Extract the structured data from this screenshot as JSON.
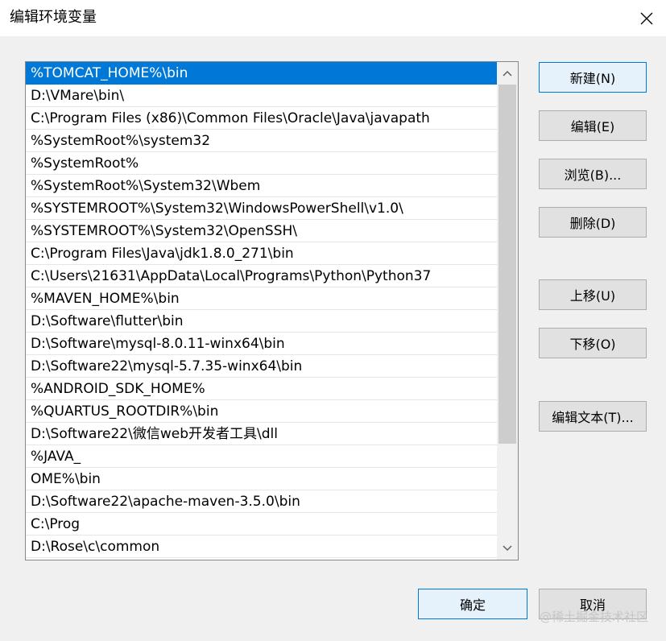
{
  "window": {
    "title": "编辑环境变量"
  },
  "list": {
    "items": [
      "%TOMCAT_HOME%\\bin",
      "D:\\VMare\\bin\\",
      "C:\\Program Files (x86)\\Common Files\\Oracle\\Java\\javapath",
      "%SystemRoot%\\system32",
      "%SystemRoot%",
      "%SystemRoot%\\System32\\Wbem",
      "%SYSTEMROOT%\\System32\\WindowsPowerShell\\v1.0\\",
      "%SYSTEMROOT%\\System32\\OpenSSH\\",
      "C:\\Program Files\\Java\\jdk1.8.0_271\\bin",
      "C:\\Users\\21631\\AppData\\Local\\Programs\\Python\\Python37",
      "%MAVEN_HOME%\\bin",
      "D:\\Software\\flutter\\bin",
      "D:\\Software\\mysql-8.0.11-winx64\\bin",
      "D:\\Software22\\mysql-5.7.35-winx64\\bin",
      "%ANDROID_SDK_HOME%",
      "%QUARTUS_ROOTDIR%\\bin",
      "D:\\Software22\\微信web开发者工具\\dll",
      "%JAVA_",
      "OME%\\bin",
      "D:\\Software22\\apache-maven-3.5.0\\bin",
      "C:\\Prog",
      "D:\\Rose\\c\\common"
    ],
    "selected_index": 0
  },
  "buttons": {
    "new": "新建(N)",
    "edit": "编辑(E)",
    "browse": "浏览(B)...",
    "delete": "删除(D)",
    "move_up": "上移(U)",
    "move_down": "下移(O)",
    "edit_text": "编辑文本(T)...",
    "ok": "确定",
    "cancel": "取消"
  },
  "watermark": "@稀土掘金技术社区",
  "colors": {
    "selection": "#0078d7",
    "default_button_border": "#0078d7"
  }
}
